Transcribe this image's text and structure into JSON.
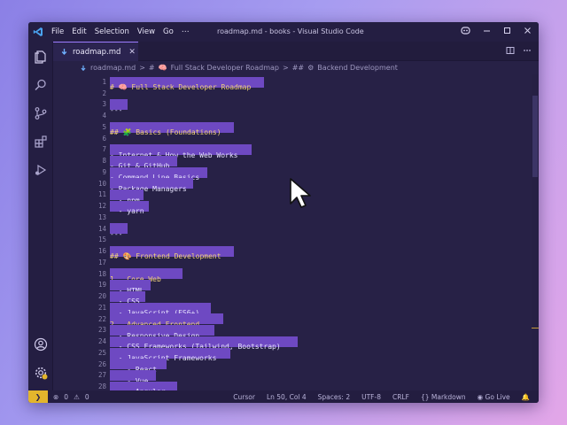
{
  "window": {
    "title": "roadmap.md - books - Visual Studio Code",
    "menu": [
      "File",
      "Edit",
      "Selection",
      "View",
      "Go",
      "⋯"
    ]
  },
  "tab": {
    "label": "roadmap.md",
    "close": "✕"
  },
  "breadcrumb": {
    "file": "roadmap.md",
    "sep1": ">",
    "h1_marker": "#",
    "h1": "Full Stack Developer Roadmap",
    "sep2": ">",
    "h2_marker": "##",
    "h2": "Backend Development"
  },
  "editor": {
    "lines": [
      {
        "n": "1",
        "text": "# 🧠 Full Stack Developer Roadmap",
        "kind": "heading",
        "sel": 174
      },
      {
        "n": "2",
        "text": "",
        "kind": "plain",
        "sel": 0
      },
      {
        "n": "3",
        "text": "---",
        "kind": "dash",
        "sel": 20
      },
      {
        "n": "4",
        "text": "",
        "kind": "plain",
        "sel": 0
      },
      {
        "n": "5",
        "text": "## 🧩 Basics (Foundations)",
        "kind": "heading",
        "sel": 140
      },
      {
        "n": "6",
        "text": "",
        "kind": "plain",
        "sel": 0
      },
      {
        "n": "7",
        "text": "- Internet & How the Web Works",
        "kind": "plain",
        "sel": 160
      },
      {
        "n": "8",
        "text": "- Git & GitHub",
        "kind": "plain",
        "sel": 76
      },
      {
        "n": "9",
        "text": "- Command Line Basics",
        "kind": "plain",
        "sel": 110
      },
      {
        "n": "10",
        "text": "- Package Managers",
        "kind": "plain",
        "sel": 94
      },
      {
        "n": "11",
        "text": "  - npm",
        "kind": "plain",
        "sel": 38
      },
      {
        "n": "12",
        "text": "  - yarn",
        "kind": "plain",
        "sel": 44
      },
      {
        "n": "13",
        "text": "",
        "kind": "plain",
        "sel": 0
      },
      {
        "n": "14",
        "text": "---",
        "kind": "dash",
        "sel": 20
      },
      {
        "n": "15",
        "text": "",
        "kind": "plain",
        "sel": 0
      },
      {
        "n": "16",
        "text": "## 🎨 Frontend Development",
        "kind": "heading",
        "sel": 140
      },
      {
        "n": "17",
        "text": "",
        "kind": "plain",
        "sel": 0
      },
      {
        "n": "18",
        "text": "1.  Core Web",
        "kind": "heading",
        "sel": 82
      },
      {
        "n": "19",
        "text": "  - HTML",
        "kind": "plain",
        "sel": 46
      },
      {
        "n": "20",
        "text": "  - CSS",
        "kind": "plain",
        "sel": 40
      },
      {
        "n": "21",
        "text": "  - JavaScript (ES6+)",
        "kind": "plain",
        "sel": 114
      },
      {
        "n": "22",
        "text": "2.  Advanced Frontend",
        "kind": "heading",
        "sel": 128
      },
      {
        "n": "23",
        "text": "  - Responsive Design",
        "kind": "plain",
        "sel": 118
      },
      {
        "n": "24",
        "text": "  - CSS Frameworks (Tailwind, Bootstrap)",
        "kind": "plain",
        "sel": 212
      },
      {
        "n": "25",
        "text": "  - JavaScript Frameworks",
        "kind": "plain",
        "sel": 136
      },
      {
        "n": "26",
        "text": "    - React",
        "kind": "plain",
        "sel": 64
      },
      {
        "n": "27",
        "text": "    - Vue",
        "kind": "plain",
        "sel": 52
      },
      {
        "n": "28",
        "text": "    - Angular",
        "kind": "plain",
        "sel": 76
      }
    ]
  },
  "statusbar": {
    "errors": "0",
    "warnings": "0",
    "cursor_label": "Cursor",
    "position": "Ln 50, Col 4",
    "spaces": "Spaces: 2",
    "encoding": "UTF-8",
    "eol": "CRLF",
    "language": "Markdown",
    "go_live": "Go Live"
  },
  "colors": {
    "selection": "#6e49c2",
    "heading": "#f3d27a",
    "accent": "#9d7cff",
    "remote_badge": "#e3b52c"
  }
}
